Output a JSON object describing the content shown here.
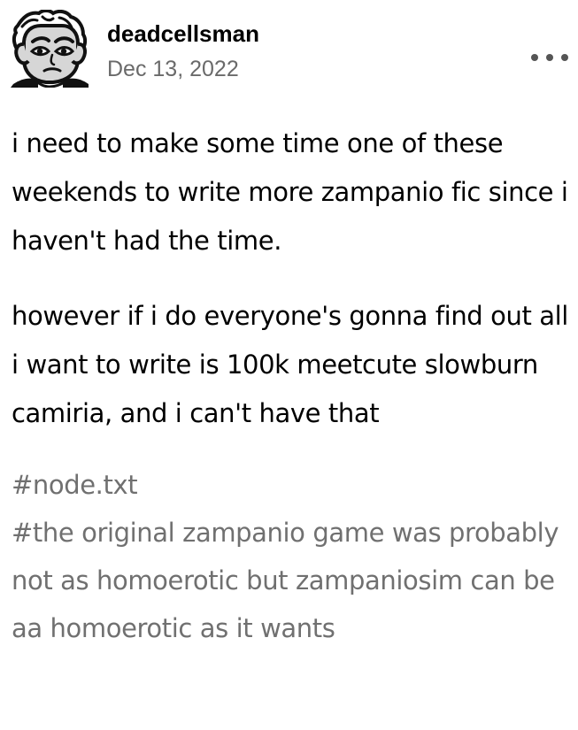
{
  "post": {
    "author": {
      "username": "deadcellsman",
      "avatar_icon": "monochrome-character-avatar"
    },
    "date": "Dec 13, 2022",
    "menu_icon": "more-options-ellipsis-icon",
    "paragraphs": [
      "i need to make some time one of these weekends to write more zampanio fic since i haven't had the time.",
      "however if i do everyone's gonna find out all i want to write is 100k meetcute slowburn camiria, and i can't have that"
    ],
    "tags": [
      "#node.txt",
      "#the original zampanio game was probably not as homoerotic but zampaniosim can be aa homoerotic as it wants"
    ]
  },
  "colors": {
    "text": "#000000",
    "meta_gray": "#6a6a6a",
    "tag_gray": "#707070",
    "background": "#ffffff"
  }
}
